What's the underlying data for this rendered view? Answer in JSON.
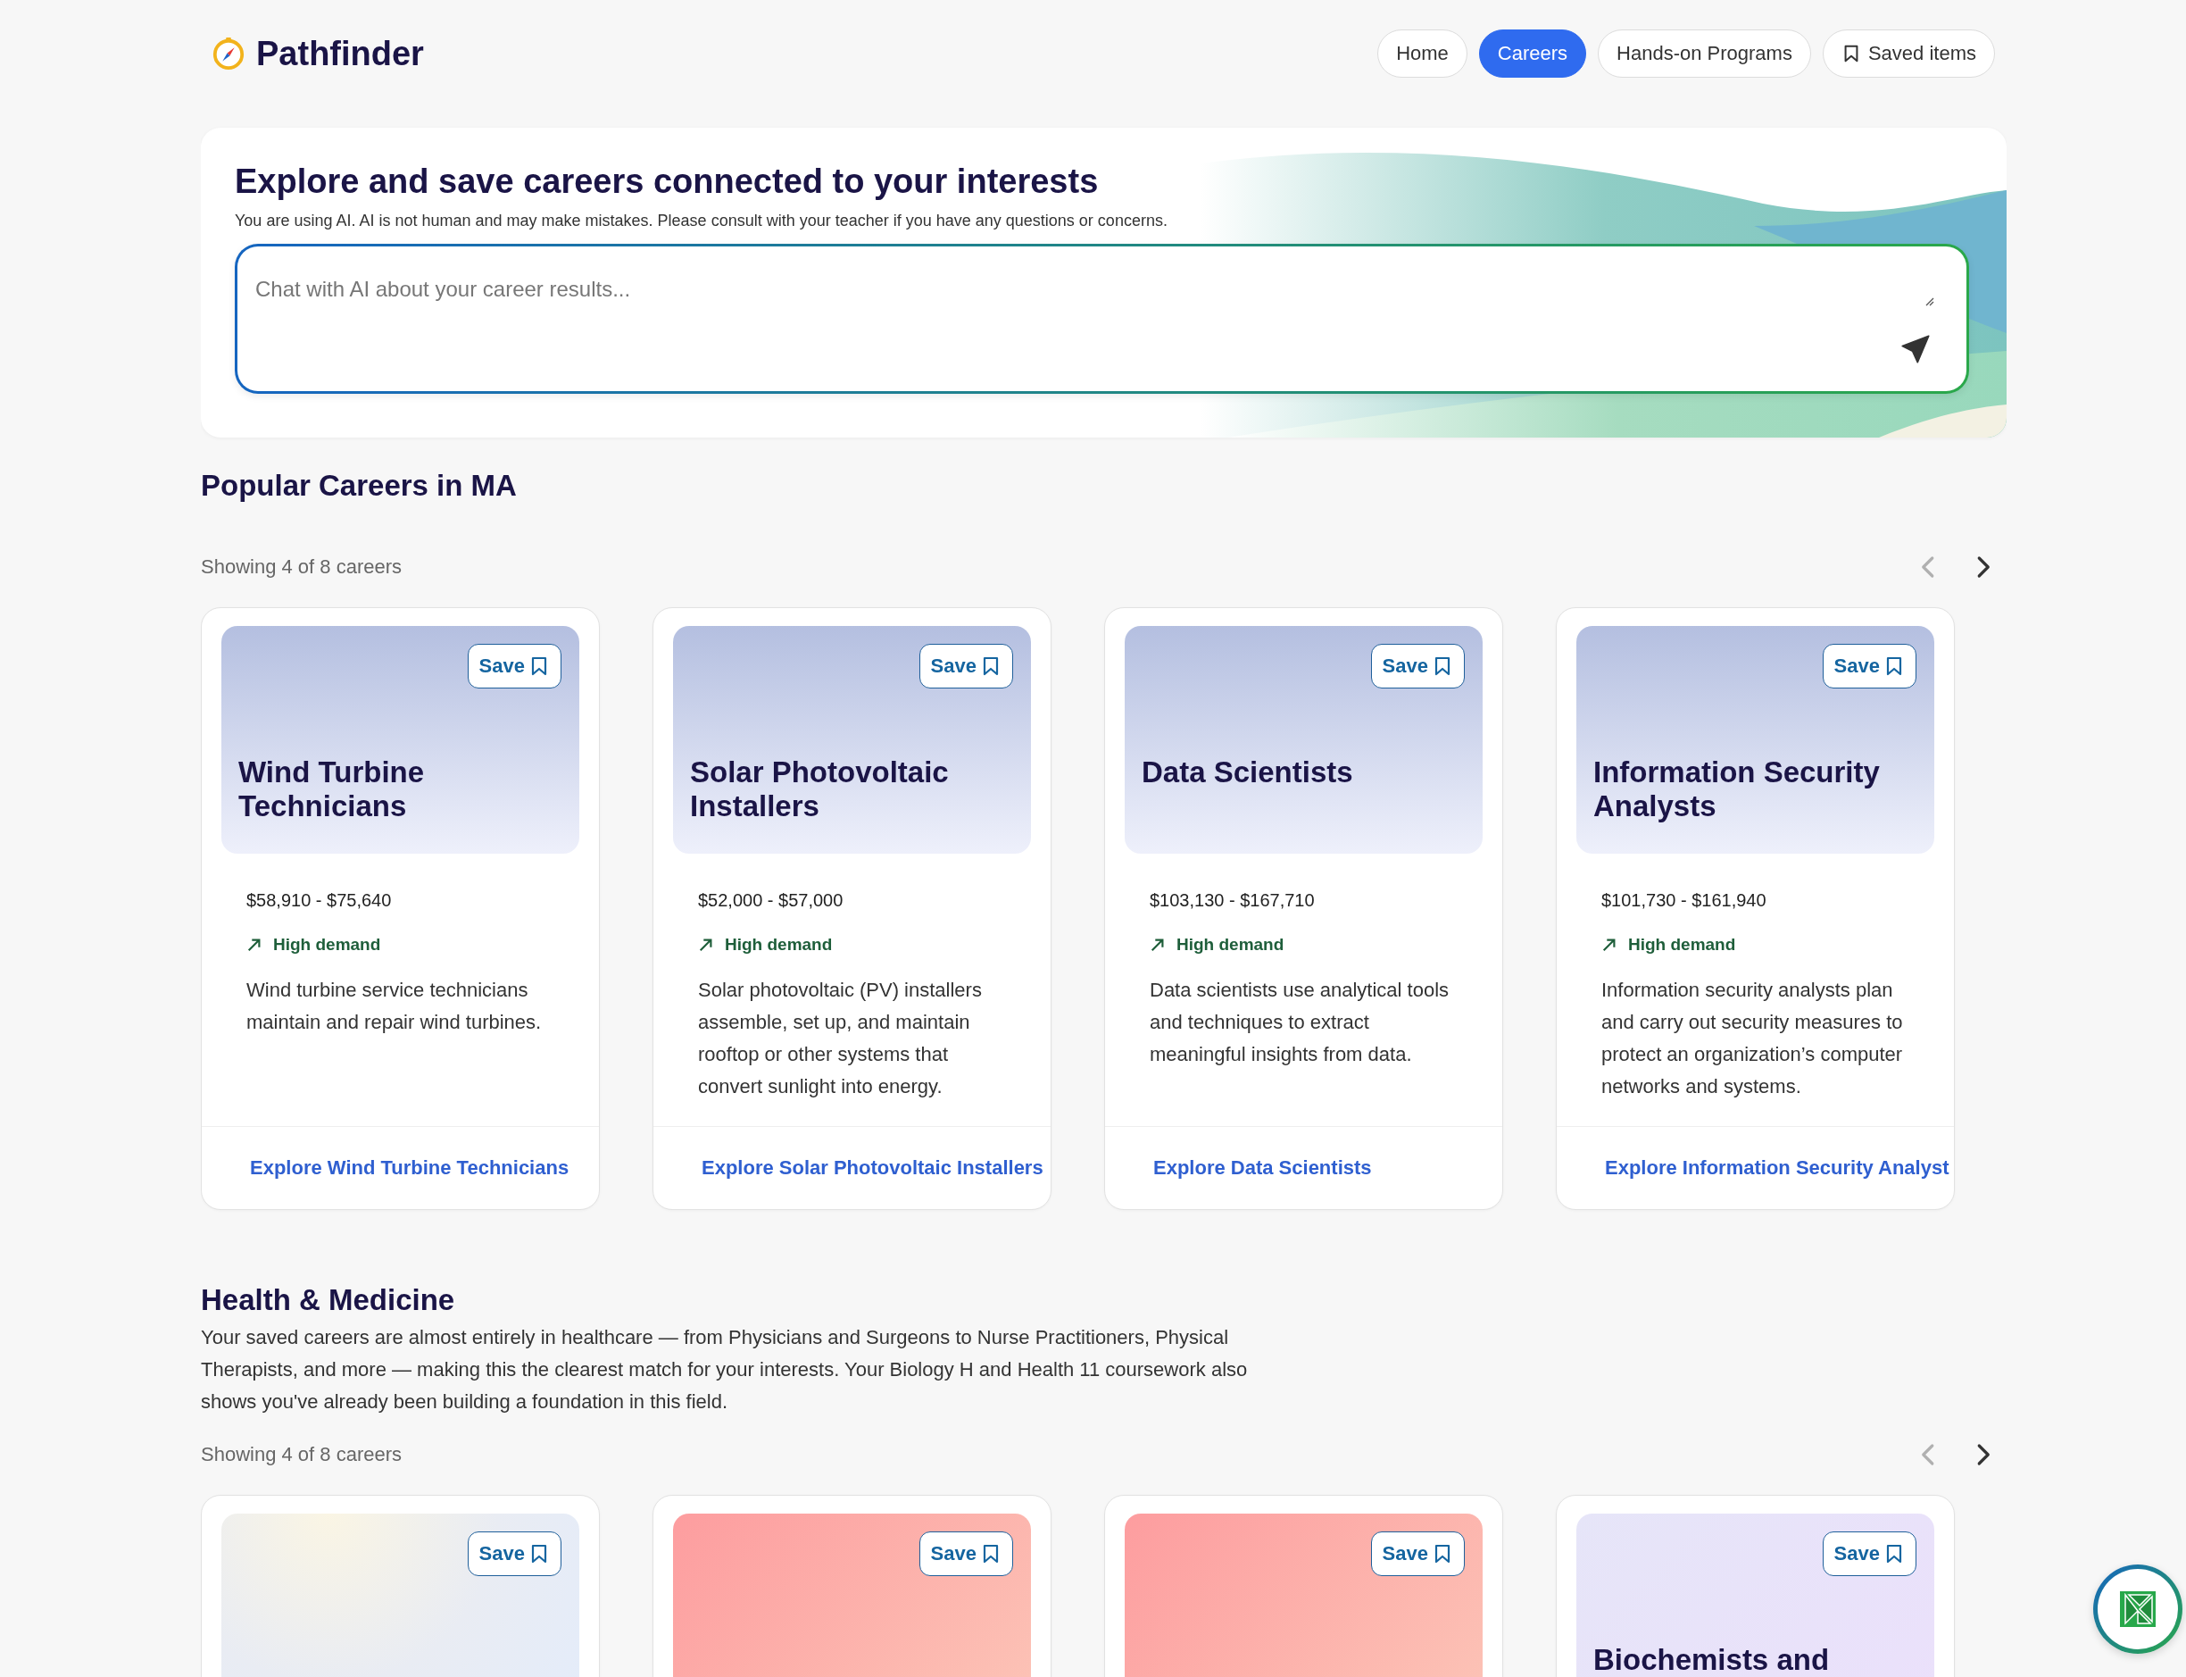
{
  "header": {
    "logo": "Pathfinder",
    "nav": [
      {
        "label": "Home",
        "selected": false,
        "kind": "text"
      },
      {
        "label": "Careers",
        "selected": true,
        "kind": "text"
      },
      {
        "label": "Hands-on Programs",
        "selected": false,
        "kind": "text"
      },
      {
        "label": "Saved items",
        "selected": false,
        "kind": "bookmark"
      }
    ]
  },
  "hero": {
    "title": "Explore and save careers connected to your interests",
    "disclaimer": "You are using AI. AI is not human and may make mistakes. Please consult with your teacher if you have any questions or concerns.",
    "chat": {
      "placeholder": "Chat with AI about your career results..."
    }
  },
  "sections": [
    {
      "title": "Popular Careers in MA",
      "count_label": "Showing 4 of 8 careers",
      "prev": {
        "disabled": true
      },
      "next": {
        "disabled": false
      },
      "careers": [
        {
          "kind": "periwinkle",
          "save_label": "Save",
          "title": "Wind Turbine Technicians",
          "salary": "$58,910 - $75,640",
          "demand": "High demand",
          "description": "Wind turbine service technicians maintain and repair wind turbines.",
          "link": "Explore Wind Turbine Technicians"
        },
        {
          "kind": "periwinkle",
          "save_label": "Save",
          "title": "Solar Photovoltaic Installers",
          "salary": "$52,000 - $57,000",
          "demand": "High demand",
          "description": "Solar photovoltaic (PV) installers assemble, set up, and maintain rooftop or other systems that convert sunlight into energy.",
          "link": "Explore Solar Photovoltaic Installers"
        },
        {
          "kind": "periwinkle",
          "save_label": "Save",
          "title": "Data Scientists",
          "salary": "$103,130 - $167,710",
          "demand": "High demand",
          "description": "Data scientists use analytical tools and techniques to extract meaningful insights from data.",
          "link": "Explore Data Scientists"
        },
        {
          "kind": "periwinkle",
          "save_label": "Save",
          "title": "Information Security Analysts",
          "salary": "$101,730 - $161,940",
          "demand": "High demand",
          "description": "Information security analysts plan and carry out security measures to protect an organization’s computer networks and systems.",
          "link": "Explore Information Security Analyst"
        }
      ]
    },
    {
      "title": "Health & Medicine",
      "description": "Your saved careers are almost entirely in healthcare — from Physicians and Surgeons to Nurse Practitioners, Physical Therapists, and more — making this the clearest match for your interests. Your Biology H and Health 11 coursework also shows you've already been building a foundation in this field.",
      "count_label": "Showing 4 of 8 careers",
      "prev": {
        "disabled": true
      },
      "next": {
        "disabled": false
      },
      "careers": [
        {
          "kind": "cream",
          "save_label": "Save"
        },
        {
          "kind": "coral",
          "save_label": "Save"
        },
        {
          "kind": "coral",
          "save_label": "Save"
        },
        {
          "kind": "lavender",
          "save_label": "Save",
          "title": "Biochemists and"
        }
      ]
    }
  ]
}
